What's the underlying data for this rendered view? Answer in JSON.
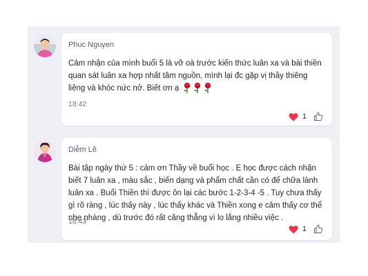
{
  "comments": [
    {
      "author": "Phuc Nguyen",
      "text": "Cảm nhận của mình buổi 5 là vỡ oà trước kiến thức luân xa và bài thiền quan sát luân xa hợp nhất tâm nguồn, mình lại đc gặp vị thầy thiêng liêng và khóc nức nở. Biết ơn ạ",
      "emoji": "rose-emoji x3",
      "time": "18:42",
      "reaction_count": "1",
      "reaction_icon": "heart-icon",
      "like_icon": "thumbs-up-icon"
    },
    {
      "author": "Diễm Lê",
      "text": "Bài tập ngày thứ 5 : cám ơn Thầy về buổi học . E học được cách nhận biết 7 luân xa , màu sắc , biến dạng và phẩm chất cần có để chữa lành luân xa . Buổi Thiền thì được ôn lại các bước 1-2-3-4 -5 . Tuy chưa thấy gì rõ ràng , lúc thấy này , lúc thấy khác và Thiền xong e cảm thấy cơ thể nhẹ nhàng , dù trước đó rất căng thẳng vì lo lắng nhiều việc .",
      "time": "18:43",
      "reaction_count": "1",
      "reaction_icon": "heart-icon",
      "like_icon": "thumbs-up-icon"
    }
  ],
  "colors": {
    "feed_background": "#eef0f5",
    "card_background": "#ffffff",
    "heart": "#e8344e",
    "rose": "#c8102e"
  }
}
